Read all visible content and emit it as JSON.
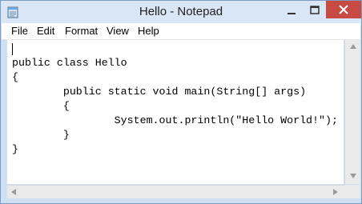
{
  "window": {
    "title": "Hello - Notepad"
  },
  "menu": {
    "items": [
      {
        "label": "File"
      },
      {
        "label": "Edit"
      },
      {
        "label": "Format"
      },
      {
        "label": "View"
      },
      {
        "label": "Help"
      }
    ]
  },
  "editor": {
    "lines": [
      "public class Hello",
      "{",
      "        public static void main(String[] args)",
      "        {",
      "                System.out.println(\"Hello World!\");",
      "        }",
      "}"
    ]
  },
  "icons": {
    "app": "notepad-icon",
    "minimize": "minimize-icon",
    "maximize": "maximize-icon",
    "close": "close-icon"
  },
  "colors": {
    "close_button": "#c74a43",
    "title_bar": "#d9e6f5"
  }
}
